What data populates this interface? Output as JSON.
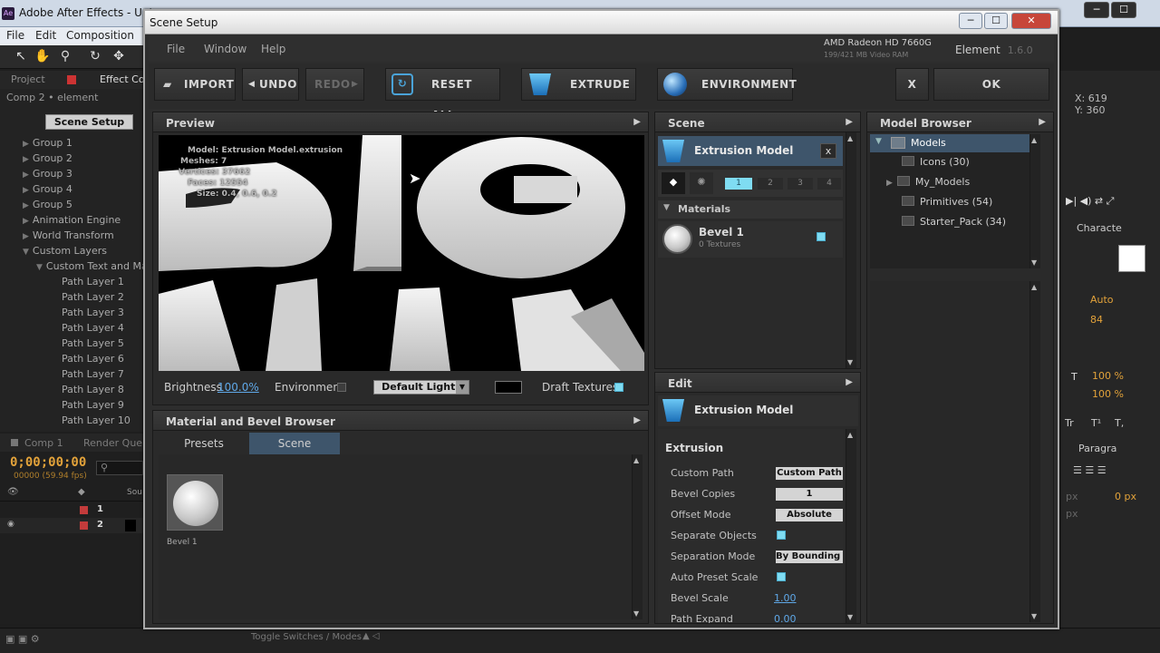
{
  "ae": {
    "title": "Adobe After Effects - Unt",
    "app_icon": "Ae",
    "window_min": "─",
    "window_max": "☐",
    "window_close": "✕",
    "menu": [
      "File",
      "Edit",
      "Composition"
    ],
    "project_tab": "Project",
    "effect_tab": "Effect Co",
    "comp_label": "Comp 2 • element",
    "scene_setup_btn": "Scene Setup",
    "tree": [
      {
        "label": "Group 1",
        "arrow": "▶"
      },
      {
        "label": "Group 2",
        "arrow": "▶"
      },
      {
        "label": "Group 3",
        "arrow": "▶"
      },
      {
        "label": "Group 4",
        "arrow": "▶"
      },
      {
        "label": "Group 5",
        "arrow": "▶"
      },
      {
        "label": "Animation Engine",
        "arrow": "▶"
      },
      {
        "label": "World Transform",
        "arrow": "▶"
      },
      {
        "label": "Custom Layers",
        "arrow": "▼"
      },
      {
        "label": "Custom Text and Ma",
        "arrow": "▼"
      },
      {
        "label": "Path Layer 1",
        "arrow": ""
      },
      {
        "label": "Path Layer 2",
        "arrow": ""
      },
      {
        "label": "Path Layer 3",
        "arrow": ""
      },
      {
        "label": "Path Layer 4",
        "arrow": ""
      },
      {
        "label": "Path Layer 5",
        "arrow": ""
      },
      {
        "label": "Path Layer 6",
        "arrow": ""
      },
      {
        "label": "Path Layer 7",
        "arrow": ""
      },
      {
        "label": "Path Layer 8",
        "arrow": ""
      },
      {
        "label": "Path Layer 9",
        "arrow": ""
      },
      {
        "label": "Path Layer 10",
        "arrow": ""
      }
    ],
    "timeline_tabs": [
      "Comp 1",
      "Render Que"
    ],
    "timecode": "0;00;00;00",
    "fps": "00000 (59.94 fps)",
    "sou": "Sou",
    "layers": [
      "1",
      "2"
    ],
    "toggle_switches": "Toggle Switches / Modes",
    "right": {
      "x": "X: 619",
      "y": "Y: 360",
      "character": "Characte",
      "auto": "Auto",
      "size": "84",
      "paragraph": "Paragra",
      "scale1": "100 %",
      "scale2": "100 %",
      "px1": "px",
      "px2": "0 px",
      "px3": "px",
      "tt": "Tr",
      "t1": "T¹",
      "t2": "T,"
    }
  },
  "dialog": {
    "title": "Scene Setup",
    "menu": [
      "File",
      "Window",
      "Help"
    ],
    "gpu": "AMD Radeon HD 7660G",
    "vram": "199/421 MB Video RAM",
    "element_label": "Element",
    "version": "1.6.0",
    "toolbar": {
      "import": "IMPORT",
      "undo": "UNDO",
      "redo": "REDO",
      "reset": "RESET ALL",
      "extrude": "EXTRUDE",
      "environment": "ENVIRONMENT",
      "close": "X",
      "ok": "OK"
    },
    "preview": {
      "title": "Preview",
      "info": [
        "Model: Extrusion Model.extrusion",
        "Meshes: 7",
        "Vertices: 37662",
        "Faces: 12554",
        "Size: 0.4, 0.6, 0.2"
      ],
      "brightness_label": "Brightness",
      "brightness": "100.0%",
      "environment_label": "Environment",
      "lights": "Default Lights",
      "draft_label": "Draft Textures"
    },
    "material_browser": {
      "title": "Material and Bevel Browser",
      "tabs": [
        "Presets",
        "Scene"
      ],
      "item": "Bevel 1"
    },
    "scene": {
      "title": "Scene",
      "model": "Extrusion Model",
      "close": "x",
      "groups": [
        "1",
        "2",
        "3",
        "4"
      ],
      "materials_label": "Materials",
      "bevel_name": "Bevel 1",
      "bevel_sub": "0 Textures"
    },
    "edit": {
      "title": "Edit",
      "model": "Extrusion Model",
      "section": "Extrusion",
      "props": [
        {
          "label": "Custom Path",
          "type": "select",
          "value": "Custom Path"
        },
        {
          "label": "Bevel Copies",
          "type": "value",
          "value": "1"
        },
        {
          "label": "Offset Mode",
          "type": "select",
          "value": "Absolute"
        },
        {
          "label": "Separate Objects",
          "type": "check",
          "value": ""
        },
        {
          "label": "Separation Mode",
          "type": "select",
          "value": "By Bounding B"
        },
        {
          "label": "Auto Preset Scale",
          "type": "check",
          "value": ""
        },
        {
          "label": "Bevel Scale",
          "type": "link",
          "value": "1.00"
        },
        {
          "label": "Path Expand",
          "type": "link",
          "value": "0.00"
        }
      ]
    },
    "model_browser": {
      "title": "Model Browser",
      "root": "Models",
      "items": [
        "Icons (30)",
        "My_Models",
        "Primitives (54)",
        "Starter_Pack (34)"
      ]
    },
    "viewport_text": [
      "BIG",
      "G",
      "R",
      "L",
      "L"
    ]
  },
  "colors": {
    "accent": "#7fdcf2",
    "link": "#5fa8e8",
    "timecode": "#e2a23a"
  }
}
